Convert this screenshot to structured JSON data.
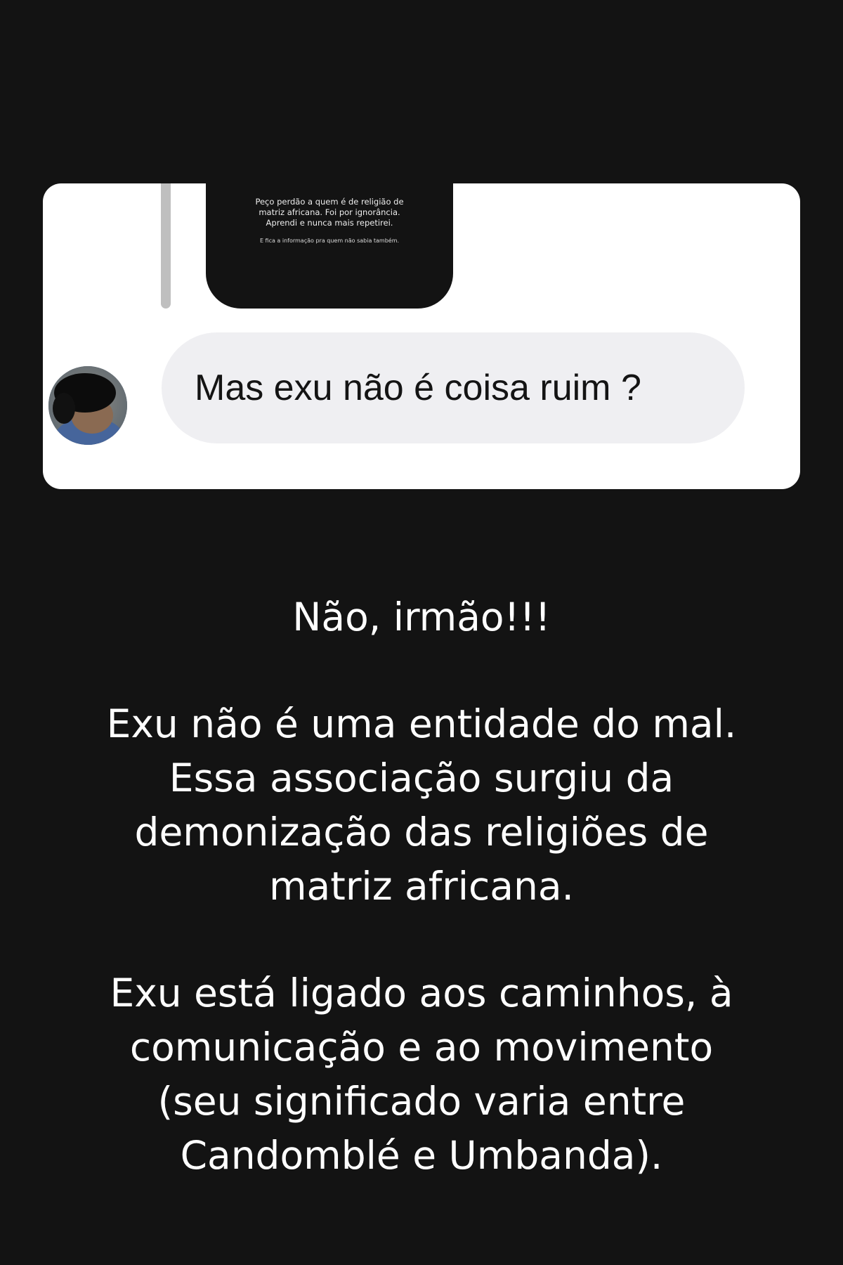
{
  "quoted_story": {
    "lines": [
      "Peço perdão a quem é de religião de",
      "matriz africana. Foi por ignorância.",
      "Aprendi e nunca mais repetirei."
    ],
    "note": "E fica a informação pra quem não sabia também."
  },
  "message": {
    "text": "Mas exu não é coisa ruim ?",
    "avatar_icon": "blurred-profile-avatar"
  },
  "reply": {
    "heading": "Não, irmão!!!",
    "paragraph1": [
      "Exu não é uma entidade do mal.",
      "Essa associação surgiu da",
      "demonização das religiões de",
      "matriz africana."
    ],
    "paragraph2": [
      "Exu está ligado aos caminhos, à",
      "comunicação e ao movimento",
      "(seu significado varia entre",
      "Candomblé e Umbanda)."
    ]
  },
  "colors": {
    "background": "#131313",
    "card": "#ffffff",
    "bubble": "#efeff2",
    "text": "#ffffff"
  }
}
